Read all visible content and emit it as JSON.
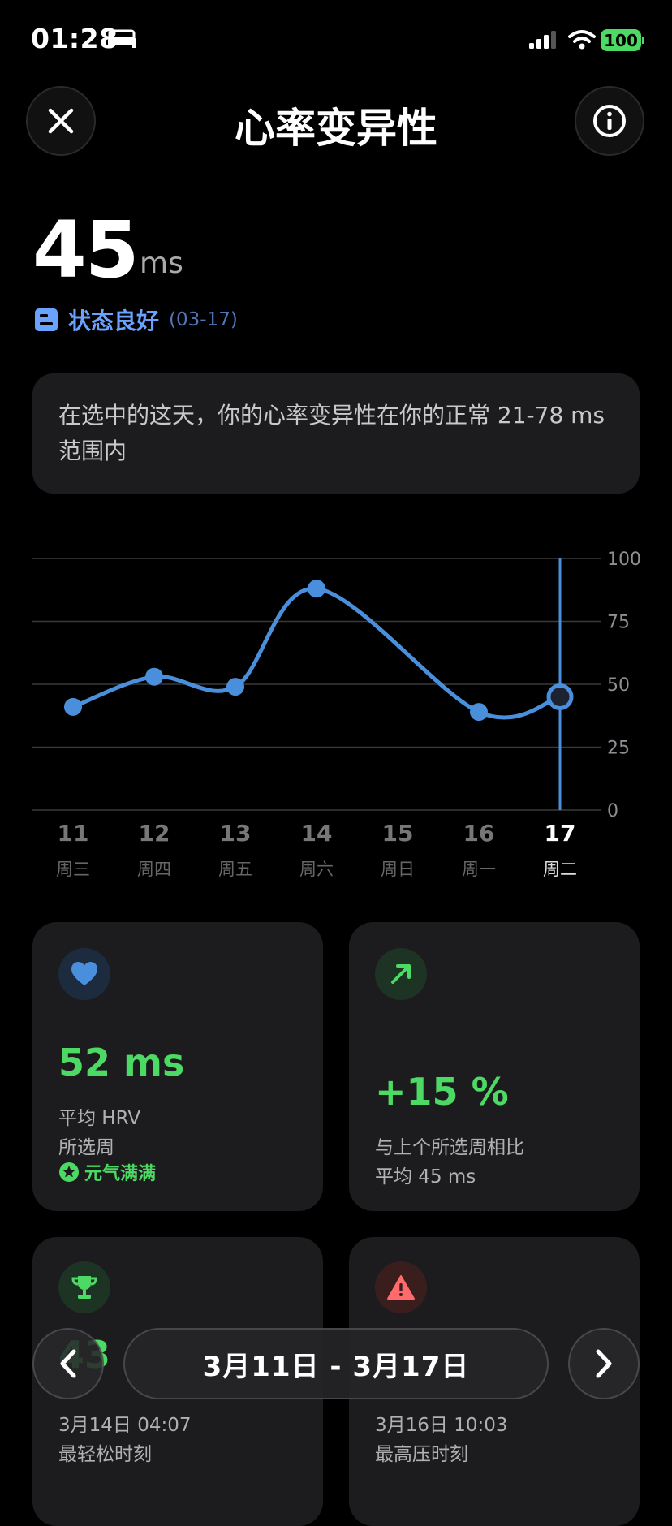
{
  "status_bar": {
    "time": "01:28",
    "battery": "100"
  },
  "header": {
    "title": "心率变异性"
  },
  "summary": {
    "value": "45",
    "unit": "ms",
    "status": "状态良好",
    "date": "(03-17)"
  },
  "description": "在选中的这天，你的心率变异性在你的正常 21-78 ms 范围内",
  "chart_data": {
    "type": "line",
    "categories": [
      "11",
      "12",
      "13",
      "14",
      "15",
      "16",
      "17"
    ],
    "weekdays": [
      "周三",
      "周四",
      "周五",
      "周六",
      "周日",
      "周一",
      "周二"
    ],
    "x_points": [
      11,
      12,
      13,
      14,
      16,
      17
    ],
    "values": [
      41,
      53,
      49,
      88,
      39,
      45
    ],
    "selected": "17",
    "ylim": [
      0,
      100
    ],
    "yticks": [
      "0",
      "25",
      "50",
      "75",
      "100"
    ],
    "grid": true,
    "line_color": "#4a8fdb"
  },
  "cards": {
    "avg": {
      "value": "52 ms",
      "label1": "平均 HRV",
      "label2": "所选周",
      "badge": "元气满满",
      "color": "#4cd964"
    },
    "change": {
      "value": "+15 %",
      "label1": "与上个所选周相比",
      "label2": "平均 45 ms",
      "color": "#4cd964"
    },
    "best": {
      "value": "43",
      "time": "3月14日 04:07",
      "label": "最轻松时刻"
    },
    "worst": {
      "time": "3月16日 10:03",
      "label": "最高压时刻"
    }
  },
  "nav": {
    "range": "3月11日 - 3月17日"
  },
  "icons": {
    "close": "close-icon",
    "info": "info-icon",
    "bed": "bed-icon",
    "heart": "heart-icon",
    "trend": "trend-up-icon",
    "trophy": "trophy-icon",
    "warning": "warning-icon",
    "prev": "chevron-left-icon",
    "next": "chevron-right-icon"
  }
}
